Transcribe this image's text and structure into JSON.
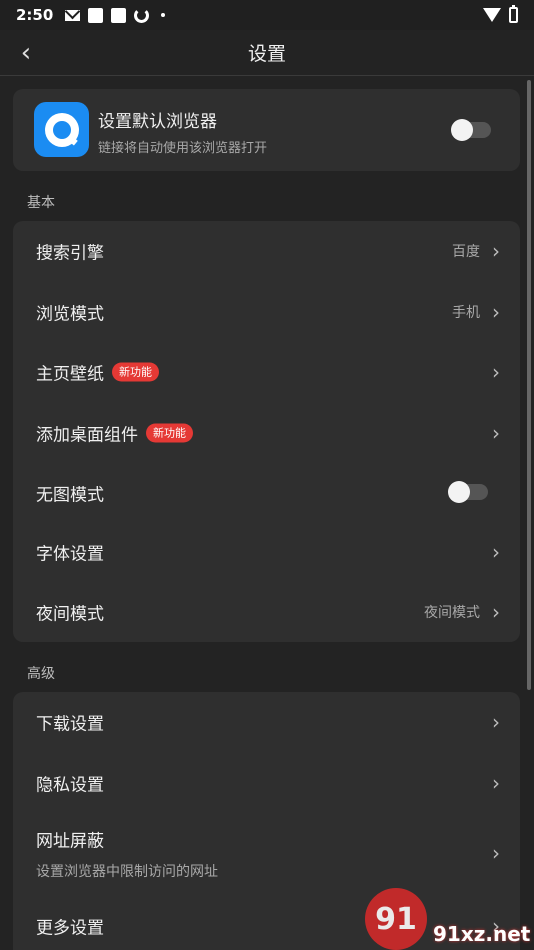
{
  "status_bar": {
    "time": "2:50",
    "icons": [
      "mail-icon",
      "notification-square-icon",
      "notification-square-icon",
      "sync-icon",
      "dot-icon"
    ],
    "right_icons": [
      "wifi-icon",
      "battery-charging-icon"
    ]
  },
  "header": {
    "title": "设置",
    "back_icon": "‹"
  },
  "default_browser": {
    "title": "设置默认浏览器",
    "subtitle": "链接将自动使用该浏览器打开",
    "toggle_on": false
  },
  "sections": {
    "basic": {
      "label": "基本",
      "items": [
        {
          "label": "搜索引擎",
          "value": "百度"
        },
        {
          "label": "浏览模式",
          "value": "手机"
        },
        {
          "label": "主页壁纸",
          "badge": "新功能"
        },
        {
          "label": "添加桌面组件",
          "badge": "新功能"
        },
        {
          "label": "无图模式",
          "toggle_on": false
        },
        {
          "label": "字体设置"
        },
        {
          "label": "夜间模式",
          "value": "夜间模式"
        }
      ]
    },
    "advanced": {
      "label": "高级",
      "items": [
        {
          "label": "下载设置"
        },
        {
          "label": "隐私设置"
        },
        {
          "label": "网址屏蔽",
          "subtitle": "设置浏览器中限制访问的网址"
        },
        {
          "label": "更多设置"
        }
      ]
    }
  },
  "chevron": "›",
  "watermark": {
    "logo_text": "91",
    "text": "91xz.net"
  },
  "colors": {
    "background": "#232323",
    "card": "#2f2f2f",
    "badge": "#e53935",
    "logo": "#1b8cf2"
  }
}
